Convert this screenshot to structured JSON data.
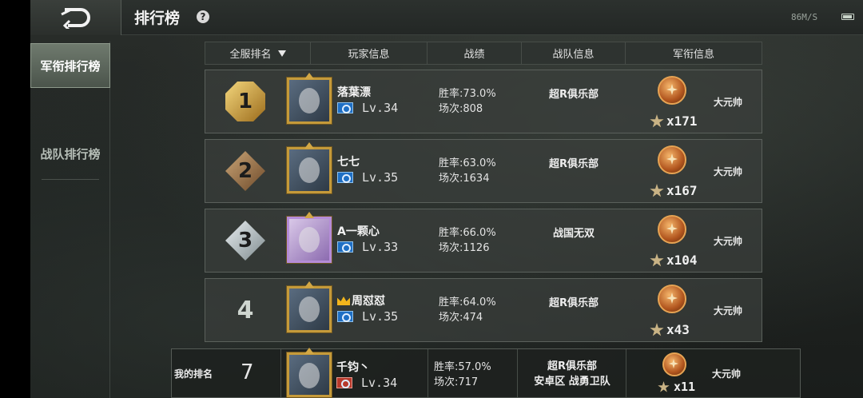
{
  "header": {
    "title": "排行榜",
    "help": "?",
    "net_status": "86M/S",
    "colors": {
      "accent_gold": "#c59a3a",
      "medal_bronze": "#b2561f"
    }
  },
  "sidebar": {
    "tabs": [
      {
        "label": "军衔排行榜",
        "active": true
      },
      {
        "label": "战队排行榜",
        "active": false
      }
    ]
  },
  "table": {
    "headers": [
      "全服排名",
      "玩家信息",
      "战绩",
      "战队信息",
      "军衔信息"
    ],
    "rows": [
      {
        "rank": "1",
        "name": "落葉漂",
        "level": "Lv.34",
        "win_rate": "胜率:73.0%",
        "matches": "场次:808",
        "team": "超R俱乐部",
        "stars": "x171",
        "rank_title": "大元帅"
      },
      {
        "rank": "2",
        "name": "七七",
        "level": "Lv.35",
        "win_rate": "胜率:63.0%",
        "matches": "场次:1634",
        "team": "超R俱乐部",
        "stars": "x167",
        "rank_title": "大元帅"
      },
      {
        "rank": "3",
        "name": "A一颗心",
        "level": "Lv.33",
        "win_rate": "胜率:66.0%",
        "matches": "场次:1126",
        "team": "战国无双",
        "stars": "x104",
        "rank_title": "大元帅"
      },
      {
        "rank": "4",
        "name": "周怼怼",
        "level": "Lv.35",
        "win_rate": "胜率:64.0%",
        "matches": "场次:474",
        "team": "超R俱乐部",
        "stars": "x43",
        "rank_title": "大元帅"
      }
    ]
  },
  "my_rank": {
    "label": "我的排名",
    "rank": "7",
    "name": "千钧丶",
    "level": "Lv.34",
    "win_rate": "胜率:57.0%",
    "matches": "场次:717",
    "team": "超R俱乐部",
    "team_tag": "安卓区 战勇卫队",
    "stars": "x11",
    "rank_title": "大元帅"
  }
}
